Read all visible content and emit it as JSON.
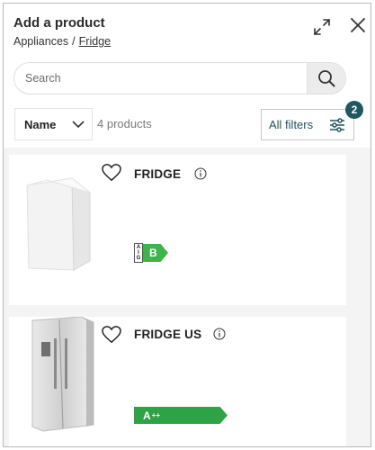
{
  "header": {
    "title": "Add a product",
    "breadcrumb": {
      "parent": "Appliances",
      "separator": "/",
      "current": "Fridge"
    }
  },
  "search": {
    "placeholder": "Search",
    "value": ""
  },
  "sort": {
    "selected": "Name"
  },
  "results": {
    "count_label": "4 products"
  },
  "filters": {
    "label": "All filters",
    "active_count": "2"
  },
  "products": [
    {
      "name": "FRIDGE",
      "energy_scale": [
        "A",
        "I",
        "G"
      ],
      "energy_class": "B",
      "energy_color": "#3db54a"
    },
    {
      "name": "FRIDGE US",
      "energy_class": "A",
      "energy_class_sup": "++",
      "energy_color": "#2ea346"
    }
  ],
  "colors": {
    "accent": "#1f5863",
    "filter_text": "#21535e",
    "energy_green": "#3db54a"
  }
}
